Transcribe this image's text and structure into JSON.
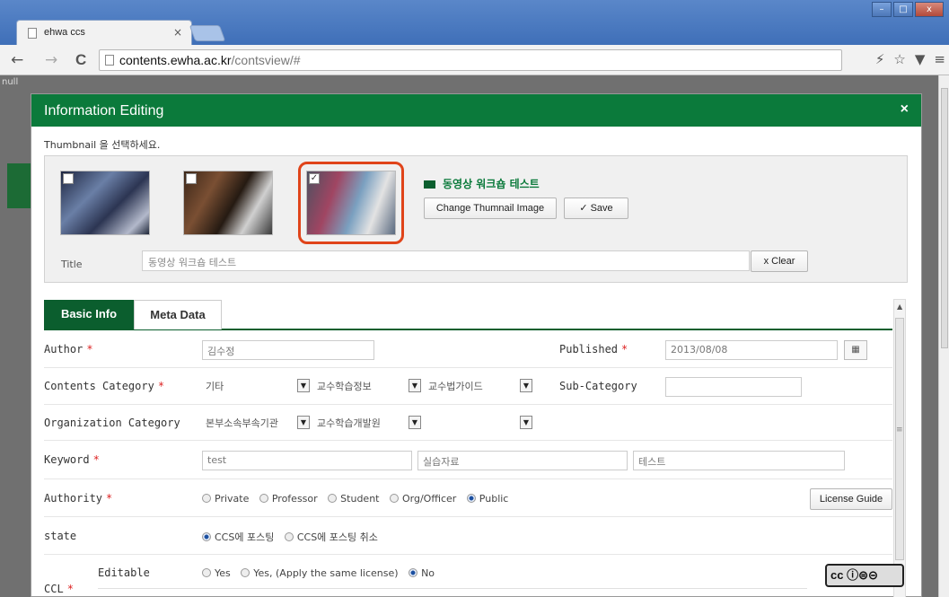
{
  "browser": {
    "tab_title": "ehwa ccs",
    "tab_close": "×",
    "url_domain": "contents.ewha.ac.kr",
    "url_path": "/contsview/#",
    "win_min": "–",
    "win_max": "□",
    "win_close": "x",
    "back": "←",
    "forward": "→",
    "reload": "C",
    "menu": "≡",
    "star": "☆",
    "ext": "⚡",
    "pocket": "▼"
  },
  "page": {
    "null_text": "null"
  },
  "modal": {
    "title": "Information Editing",
    "close": "×",
    "thumbnail_hint": "Thumbnail 을 선택하세요.",
    "thumbnails": [
      {
        "checked": false,
        "mark": ""
      },
      {
        "checked": false,
        "mark": ""
      },
      {
        "checked": true,
        "mark": "✓"
      }
    ],
    "video_title": "동영상 워크숍 테스트",
    "change_thumb_btn": "Change Thumnail Image",
    "save_btn": "Save",
    "save_icon": "✓",
    "title_label": "Title",
    "title_value": "동영상 워크숍 테스트",
    "clear_btn": "Clear",
    "clear_icon": "x"
  },
  "tabs": {
    "basic": "Basic Info",
    "meta": "Meta Data"
  },
  "form": {
    "author": {
      "label": "Author",
      "value": "김수정"
    },
    "published": {
      "label": "Published",
      "value": "2013/08/08",
      "icon": "▦"
    },
    "contents_category": {
      "label": "Contents Category",
      "sel1": "기타",
      "sel2": "교수학습정보",
      "sel3": "교수법가이드"
    },
    "sub_category": {
      "label": "Sub-Category",
      "value": ""
    },
    "org_category": {
      "label": "Organization Category",
      "sel1": "본부소속부속기관",
      "sel2": "교수학습개발원",
      "sel3": ""
    },
    "keyword": {
      "label": "Keyword",
      "k1": "test",
      "k2": "실습자료",
      "k3": "테스트"
    },
    "authority": {
      "label": "Authority",
      "options": [
        "Private",
        "Professor",
        "Student",
        "Org/Officer",
        "Public"
      ],
      "selected": "Public",
      "license_btn": "License Guide"
    },
    "state": {
      "label": "state",
      "options": [
        "CCS에 포스팅",
        "CCS에 포스팅 취소"
      ],
      "selected": "CCS에 포스팅"
    },
    "ccl": {
      "label": "CCL",
      "editable_label": "Editable",
      "options": [
        "Yes",
        "Yes, (Apply the same license)",
        "No"
      ],
      "selected": "No",
      "badge": "cc ⓘ⊜⊝"
    },
    "required_mark": "*",
    "dropdown_arrow": "▼"
  }
}
